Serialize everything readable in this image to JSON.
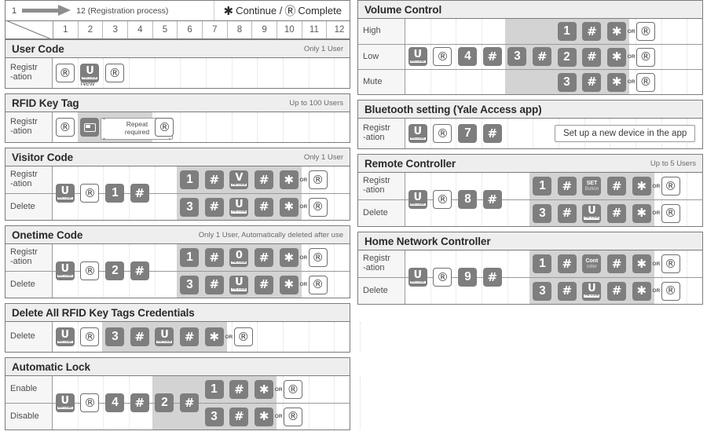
{
  "legend": {
    "start": "1",
    "end_text": "12 (Registration process)",
    "continue_symbol": "✱",
    "continue_label": "Continue /",
    "complete_symbol": "Ⓡ",
    "complete_label": "Complete"
  },
  "columns": {
    "headers": [
      "1",
      "2",
      "3",
      "4",
      "5",
      "6",
      "7",
      "8",
      "9",
      "10",
      "11",
      "12"
    ]
  },
  "keys": {
    "pin_sub": "PIN CODE",
    "or": "OR",
    "new_label": "New",
    "repeat_label": "Repeat\nrequired",
    "set_button_l1": "SET",
    "set_button_l2": "Button",
    "controller_l1": "Cont",
    "controller_l2": "roller",
    "app_instruction": "Set up  a new device in the app"
  },
  "sections": [
    {
      "id": "user-code",
      "title": "User Code",
      "note": "Only 1 User",
      "column": "left",
      "rows": [
        {
          "label": [
            "Registr",
            "-ation"
          ],
          "band": null,
          "keys": [
            {
              "col": 1,
              "type": "reg"
            },
            {
              "col": 2,
              "type": "pin",
              "glyph": "U",
              "caption": "New"
            },
            {
              "col": 3,
              "type": "reg"
            }
          ]
        }
      ]
    },
    {
      "id": "rfid-key-tag",
      "title": "RFID Key Tag",
      "note": "Up to 100 Users",
      "column": "left",
      "rows": [
        {
          "label": [
            "Registr",
            "-ation"
          ],
          "band": {
            "from": 2,
            "to": 4
          },
          "keys": [
            {
              "col": 1,
              "type": "reg"
            },
            {
              "col": 2,
              "type": "card",
              "bubble": "Repeat\nrequired"
            },
            {
              "col": 5,
              "type": "reg"
            }
          ]
        }
      ]
    },
    {
      "id": "visitor-code",
      "title": "Visitor Code",
      "note": "Only 1 User",
      "column": "left",
      "shared_prefix": [
        {
          "col": 1,
          "type": "pin",
          "glyph": "U"
        },
        {
          "col": 2,
          "type": "reg"
        },
        {
          "col": 3,
          "type": "num",
          "glyph": "1"
        },
        {
          "col": 4,
          "type": "hash"
        }
      ],
      "band": {
        "from": 6,
        "to": 10
      },
      "rows": [
        {
          "label": [
            "Registr",
            "-ation"
          ],
          "keys": [
            {
              "col": 6,
              "type": "num",
              "glyph": "1"
            },
            {
              "col": 7,
              "type": "hash"
            },
            {
              "col": 8,
              "type": "pin",
              "glyph": "V"
            },
            {
              "col": 9,
              "type": "hash"
            },
            {
              "col": 10,
              "type": "star"
            },
            {
              "col": 11,
              "type": "reg",
              "or": true
            }
          ]
        },
        {
          "label": [
            "Delete"
          ],
          "keys": [
            {
              "col": 6,
              "type": "num",
              "glyph": "3"
            },
            {
              "col": 7,
              "type": "hash"
            },
            {
              "col": 8,
              "type": "pin",
              "glyph": "U"
            },
            {
              "col": 9,
              "type": "hash"
            },
            {
              "col": 10,
              "type": "star"
            },
            {
              "col": 11,
              "type": "reg",
              "or": true
            }
          ]
        }
      ]
    },
    {
      "id": "onetime-code",
      "title": "Onetime Code",
      "note": "Only 1 User, Automatically deleted after use",
      "column": "left",
      "shared_prefix": [
        {
          "col": 1,
          "type": "pin",
          "glyph": "U"
        },
        {
          "col": 2,
          "type": "reg"
        },
        {
          "col": 3,
          "type": "num",
          "glyph": "2"
        },
        {
          "col": 4,
          "type": "hash"
        }
      ],
      "band": {
        "from": 6,
        "to": 10
      },
      "rows": [
        {
          "label": [
            "Registr",
            "-ation"
          ],
          "keys": [
            {
              "col": 6,
              "type": "num",
              "glyph": "1"
            },
            {
              "col": 7,
              "type": "hash"
            },
            {
              "col": 8,
              "type": "pin",
              "glyph": "0"
            },
            {
              "col": 9,
              "type": "hash"
            },
            {
              "col": 10,
              "type": "star"
            },
            {
              "col": 11,
              "type": "reg",
              "or": true
            }
          ]
        },
        {
          "label": [
            "Delete"
          ],
          "keys": [
            {
              "col": 6,
              "type": "num",
              "glyph": "3"
            },
            {
              "col": 7,
              "type": "hash"
            },
            {
              "col": 8,
              "type": "pin",
              "glyph": "U"
            },
            {
              "col": 9,
              "type": "hash"
            },
            {
              "col": 10,
              "type": "star"
            },
            {
              "col": 11,
              "type": "reg",
              "or": true
            }
          ]
        }
      ]
    },
    {
      "id": "delete-all-rfid",
      "title": "Delete All RFID Key Tags Credentials",
      "note": "",
      "column": "left",
      "rows": [
        {
          "label": [
            "Delete"
          ],
          "band": {
            "from": 3,
            "to": 7
          },
          "keys": [
            {
              "col": 1,
              "type": "pin",
              "glyph": "U"
            },
            {
              "col": 2,
              "type": "reg"
            },
            {
              "col": 3,
              "type": "num",
              "glyph": "3"
            },
            {
              "col": 4,
              "type": "hash"
            },
            {
              "col": 5,
              "type": "pin",
              "glyph": "U"
            },
            {
              "col": 6,
              "type": "hash"
            },
            {
              "col": 7,
              "type": "star"
            },
            {
              "col": 8,
              "type": "reg",
              "or": true
            }
          ]
        }
      ]
    },
    {
      "id": "automatic-lock",
      "title": "Automatic Lock",
      "note": "",
      "column": "left",
      "shared_prefix": [
        {
          "col": 1,
          "type": "pin",
          "glyph": "U"
        },
        {
          "col": 2,
          "type": "reg"
        },
        {
          "col": 3,
          "type": "num",
          "glyph": "4"
        },
        {
          "col": 4,
          "type": "hash"
        },
        {
          "col": 5,
          "type": "num",
          "glyph": "2"
        },
        {
          "col": 6,
          "type": "hash"
        }
      ],
      "band": {
        "from": 5,
        "to": 9
      },
      "rows": [
        {
          "label": [
            "Enable"
          ],
          "keys": [
            {
              "col": 7,
              "type": "num",
              "glyph": "1"
            },
            {
              "col": 8,
              "type": "hash"
            },
            {
              "col": 9,
              "type": "star"
            },
            {
              "col": 10,
              "type": "reg",
              "or": true
            }
          ]
        },
        {
          "label": [
            "Disable"
          ],
          "keys": [
            {
              "col": 7,
              "type": "num",
              "glyph": "3"
            },
            {
              "col": 8,
              "type": "hash"
            },
            {
              "col": 9,
              "type": "star"
            },
            {
              "col": 10,
              "type": "reg",
              "or": true
            }
          ]
        }
      ]
    },
    {
      "id": "volume-control",
      "title": "Volume Control",
      "note": "",
      "column": "right",
      "shared_prefix": [
        {
          "col": 1,
          "type": "pin",
          "glyph": "U"
        },
        {
          "col": 2,
          "type": "reg"
        },
        {
          "col": 3,
          "type": "num",
          "glyph": "4"
        },
        {
          "col": 4,
          "type": "hash"
        },
        {
          "col": 5,
          "type": "num",
          "glyph": "3"
        },
        {
          "col": 6,
          "type": "hash"
        }
      ],
      "band": {
        "from": 5,
        "to": 9
      },
      "rows": [
        {
          "label": [
            "High"
          ],
          "keys": [
            {
              "col": 7,
              "type": "num",
              "glyph": "1"
            },
            {
              "col": 8,
              "type": "hash"
            },
            {
              "col": 9,
              "type": "star"
            },
            {
              "col": 10,
              "type": "reg",
              "or": true
            }
          ]
        },
        {
          "label": [
            "Low"
          ],
          "keys": [
            {
              "col": 7,
              "type": "num",
              "glyph": "2"
            },
            {
              "col": 8,
              "type": "hash"
            },
            {
              "col": 9,
              "type": "star"
            },
            {
              "col": 10,
              "type": "reg",
              "or": true
            }
          ]
        },
        {
          "label": [
            "Mute"
          ],
          "keys": [
            {
              "col": 7,
              "type": "num",
              "glyph": "3"
            },
            {
              "col": 8,
              "type": "hash"
            },
            {
              "col": 9,
              "type": "star"
            },
            {
              "col": 10,
              "type": "reg",
              "or": true
            }
          ]
        }
      ]
    },
    {
      "id": "bluetooth-setting",
      "title": "Bluetooth setting (Yale Access app)",
      "note": "",
      "column": "right",
      "rows": [
        {
          "label": [
            "Registr",
            "-ation"
          ],
          "band": null,
          "keys": [
            {
              "col": 1,
              "type": "pin",
              "glyph": "U"
            },
            {
              "col": 2,
              "type": "reg"
            },
            {
              "col": 3,
              "type": "num",
              "glyph": "7"
            },
            {
              "col": 4,
              "type": "hash"
            }
          ],
          "appbox": "Set up  a new device in the app"
        }
      ]
    },
    {
      "id": "remote-controller",
      "title": "Remote Controller",
      "note": "Up to 5 Users",
      "column": "right",
      "shared_prefix": [
        {
          "col": 1,
          "type": "pin",
          "glyph": "U"
        },
        {
          "col": 2,
          "type": "reg"
        },
        {
          "col": 3,
          "type": "num",
          "glyph": "8"
        },
        {
          "col": 4,
          "type": "hash"
        }
      ],
      "band": {
        "from": 6,
        "to": 10
      },
      "rows": [
        {
          "label": [
            "Registr",
            "-ation"
          ],
          "keys": [
            {
              "col": 6,
              "type": "num",
              "glyph": "1"
            },
            {
              "col": 7,
              "type": "hash"
            },
            {
              "col": 8,
              "type": "txt2",
              "l1": "SET",
              "l2": "Button"
            },
            {
              "col": 9,
              "type": "hash"
            },
            {
              "col": 10,
              "type": "star"
            },
            {
              "col": 11,
              "type": "reg",
              "or": true
            }
          ]
        },
        {
          "label": [
            "Delete"
          ],
          "keys": [
            {
              "col": 6,
              "type": "num",
              "glyph": "3"
            },
            {
              "col": 7,
              "type": "hash"
            },
            {
              "col": 8,
              "type": "pin",
              "glyph": "U"
            },
            {
              "col": 9,
              "type": "hash"
            },
            {
              "col": 10,
              "type": "star"
            },
            {
              "col": 11,
              "type": "reg",
              "or": true
            }
          ]
        }
      ]
    },
    {
      "id": "home-network-controller",
      "title": "Home Network Controller",
      "note": "",
      "column": "right",
      "shared_prefix": [
        {
          "col": 1,
          "type": "pin",
          "glyph": "U"
        },
        {
          "col": 2,
          "type": "reg"
        },
        {
          "col": 3,
          "type": "num",
          "glyph": "9"
        },
        {
          "col": 4,
          "type": "hash"
        }
      ],
      "band": {
        "from": 6,
        "to": 10
      },
      "rows": [
        {
          "label": [
            "Registr",
            "-ation"
          ],
          "keys": [
            {
              "col": 6,
              "type": "num",
              "glyph": "1"
            },
            {
              "col": 7,
              "type": "hash"
            },
            {
              "col": 8,
              "type": "txt2",
              "l1": "Cont",
              "l2": "roller"
            },
            {
              "col": 9,
              "type": "hash"
            },
            {
              "col": 10,
              "type": "star"
            },
            {
              "col": 11,
              "type": "reg",
              "or": true
            }
          ]
        },
        {
          "label": [
            "Delete"
          ],
          "keys": [
            {
              "col": 6,
              "type": "num",
              "glyph": "3"
            },
            {
              "col": 7,
              "type": "hash"
            },
            {
              "col": 8,
              "type": "pin",
              "glyph": "U"
            },
            {
              "col": 9,
              "type": "hash"
            },
            {
              "col": 10,
              "type": "star"
            },
            {
              "col": 11,
              "type": "reg",
              "or": true
            }
          ]
        }
      ]
    }
  ]
}
